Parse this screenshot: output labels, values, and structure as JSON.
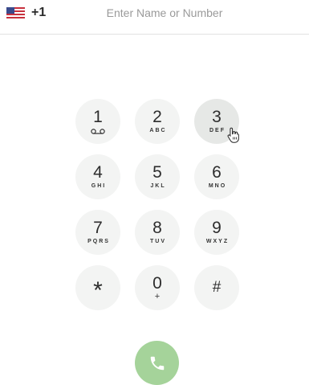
{
  "header": {
    "country_icon": "us-flag-icon",
    "country_code": "+1",
    "input_placeholder": "Enter Name or Number",
    "input_value": ""
  },
  "keypad": {
    "keys": [
      {
        "digit": "1",
        "letters": "",
        "icon": "voicemail-icon"
      },
      {
        "digit": "2",
        "letters": "ABC"
      },
      {
        "digit": "3",
        "letters": "DEF"
      },
      {
        "digit": "4",
        "letters": "GHI"
      },
      {
        "digit": "5",
        "letters": "JKL"
      },
      {
        "digit": "6",
        "letters": "MNO"
      },
      {
        "digit": "7",
        "letters": "PQRS"
      },
      {
        "digit": "8",
        "letters": "TUV"
      },
      {
        "digit": "9",
        "letters": "WXYZ"
      },
      {
        "digit": "*",
        "letters": ""
      },
      {
        "digit": "0",
        "letters": "+"
      },
      {
        "digit": "#",
        "letters": ""
      }
    ]
  },
  "call": {
    "icon": "phone-icon",
    "color": "#a5d39a"
  },
  "colors": {
    "key_background": "#f3f4f3",
    "key_hover_background": "#e6e8e6",
    "divider": "#e2e2e2"
  }
}
